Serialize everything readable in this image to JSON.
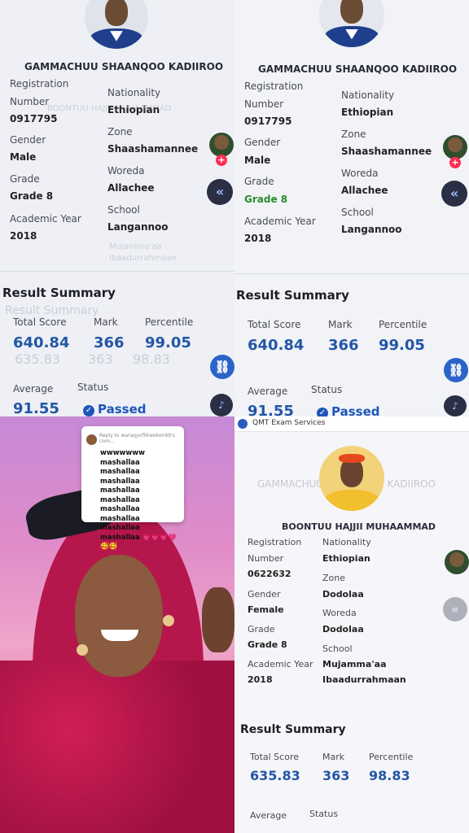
{
  "panels": {
    "top_left": {
      "student_name": "GAMMACHUU SHAANQOO KADIIROO",
      "registration_label": "Registration",
      "number_label": "Number",
      "registration_number": "0917795",
      "nationality_label": "Nationality",
      "nationality": "Ethiopian",
      "gender_label": "Gender",
      "gender": "Male",
      "zone_label": "Zone",
      "zone": "Shaashamannee",
      "grade_label": "Grade",
      "grade": "Grade 8",
      "woreda_label": "Woreda",
      "woreda": "Allachee",
      "academic_year_label": "Academic Year",
      "academic_year": "2018",
      "school_label": "School",
      "school": "Langannoo",
      "result_summary": "Result Summary",
      "total_score_label": "Total Score",
      "total_score": "640.84",
      "mark_label": "Mark",
      "mark": "366",
      "percentile_label": "Percentile",
      "percentile": "99.05",
      "average_label": "Average",
      "average": "91.55",
      "status_label": "Status",
      "status": "Passed"
    },
    "top_right": {
      "student_name": "GAMMACHUU SHAANQOO KADIIROO",
      "registration_label": "Registration",
      "number_label": "Number",
      "registration_number": "0917795",
      "nationality_label": "Nationality",
      "nationality": "Ethiopian",
      "gender_label": "Gender",
      "gender": "Male",
      "zone_label": "Zone",
      "zone": "Shaashamannee",
      "grade_label": "Grade",
      "grade": "Grade 8",
      "woreda_label": "Woreda",
      "woreda": "Allachee",
      "academic_year_label": "Academic Year",
      "academic_year": "2018",
      "school_label": "School",
      "school": "Langannoo",
      "result_summary": "Result Summary",
      "total_score_label": "Total Score",
      "total_score": "640.84",
      "mark_label": "Mark",
      "mark": "366",
      "percentile_label": "Percentile",
      "percentile": "99.05",
      "average_label": "Average",
      "average": "91.55",
      "status_label": "Status",
      "status": "Passed"
    },
    "bottom_left": {
      "reply_header": "Reply to waraqyoflikweken69's com...",
      "reply_text": "wwwwwww mashallaa mashallaa mashallaa mashallaa mashallaa mashallaa mashallaa mashallaa mashallaa 💗💗💗💗 🥰🥰"
    },
    "bottom_right": {
      "app_title": "QMT Exam Services",
      "ghost_name": "GAMMACHUU SHAANQOO KADIIROO",
      "student_name": "BOONTUU HAJJII MUHAAMMAD",
      "registration_label": "Registration",
      "number_label": "Number",
      "registration_number": "0622632",
      "nationality_label": "Nationality",
      "nationality": "Ethiopian",
      "gender_label": "Gender",
      "gender": "Female",
      "zone_label": "Zone",
      "zone": "Dodolaa",
      "grade_label": "Grade",
      "grade": "Grade 8",
      "woreda_label": "Woreda",
      "woreda": "Dodolaa",
      "academic_year_label": "Academic Year",
      "academic_year": "2018",
      "school_label": "School",
      "school": "Mujamma'aa",
      "school_line2": "Ibaadurrahmaan",
      "result_summary": "Result Summary",
      "total_score_label": "Total Score",
      "total_score": "635.83",
      "mark_label": "Mark",
      "mark": "363",
      "percentile_label": "Percentile",
      "percentile": "98.83",
      "average_label": "Average",
      "status_label": "Status"
    }
  },
  "ghost_overlay": {
    "name_fragment": "BOONTUU HAJJII MUHAAMMAD",
    "school_fragment": "Mujamma'aa",
    "school_fragment2": "Ibaadurrahmaan",
    "result_summary": "Result Summary",
    "total_score": "635.83",
    "mark": "363",
    "percentile": "98.83"
  },
  "colors": {
    "accent_blue": "#2356a6",
    "status_blue": "#1e56b8",
    "tiktok_plus": "#ff2d55",
    "hijab": "#b5174c"
  },
  "icons": [
    "plus-icon",
    "chevron-double-left-icon",
    "link-icon",
    "comment-icon",
    "check-circle-icon"
  ]
}
